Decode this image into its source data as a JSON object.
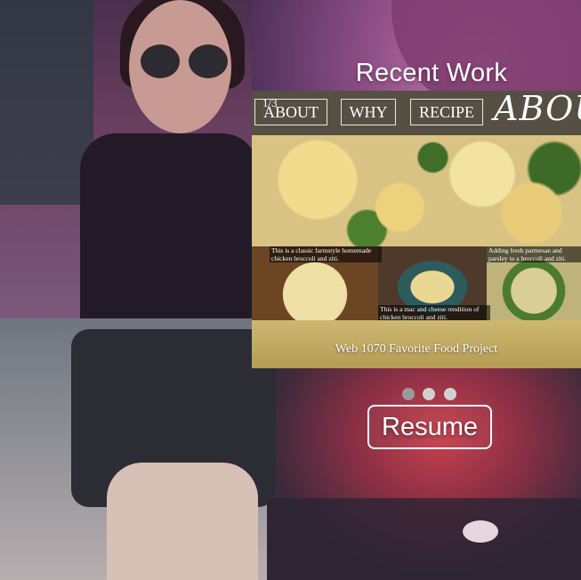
{
  "section": {
    "title": "Recent Work"
  },
  "slider": {
    "counter": "1/3",
    "nav": {
      "about": "ABOUT",
      "why": "WHY",
      "recipe": "RECIPE"
    },
    "brand_text": "ABOU",
    "thumb_captions": [
      "This is a classic farmstyle homemade chicken broccoli and ziti.",
      "This is a mac and cheese rendition of chicken broccoli and ziti.",
      "Adding fresh parmesan and parsley to a broccoli and ziti."
    ],
    "caption": "Web 1070 Favorite Food Project",
    "dots": [
      {
        "state": "active",
        "color": "#9a9a9a"
      },
      {
        "state": "inactive",
        "color": "#d0d0d0"
      },
      {
        "state": "inactive",
        "color": "#d0d0d0"
      }
    ]
  },
  "resume_button": {
    "label": "Resume"
  }
}
